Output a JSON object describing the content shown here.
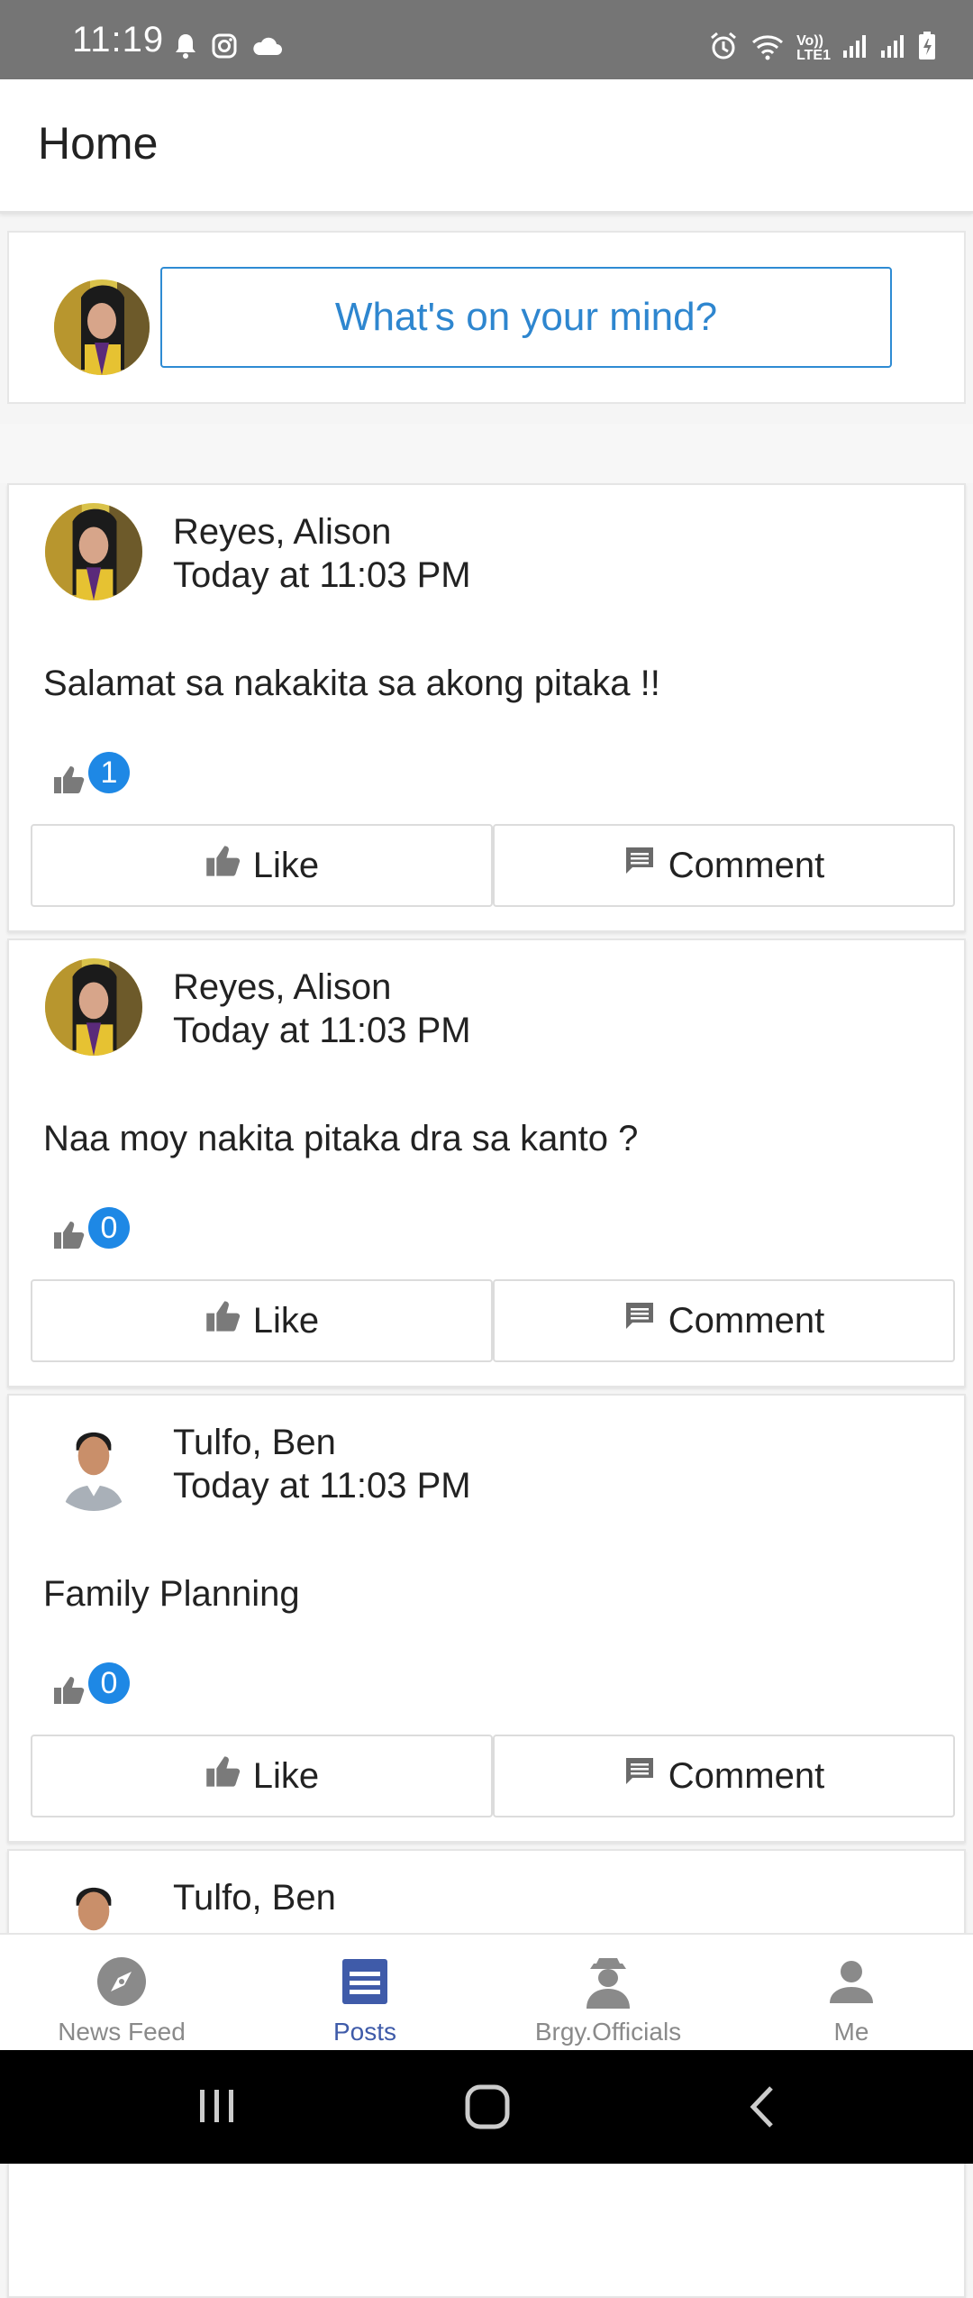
{
  "status_bar": {
    "time": "11:19",
    "lte": "LTE1",
    "vo": "Vo))",
    "icons": [
      "bell-icon",
      "instagram-icon",
      "cloud-icon",
      "alarm-icon",
      "wifi-icon",
      "signal-icon",
      "battery-icon"
    ]
  },
  "header": {
    "title": "Home"
  },
  "composer": {
    "placeholder": "What's on your mind?"
  },
  "posts": [
    {
      "author": "Reyes, Alison",
      "time": "Today at 11:03 PM",
      "text": "Salamat sa nakakita sa akong pitaka !!",
      "likes": "1",
      "like_label": "Like",
      "comment_label": "Comment"
    },
    {
      "author": "Reyes, Alison",
      "time": "Today at 11:03 PM",
      "text": "Naa moy nakita pitaka dra sa kanto ?",
      "likes": "0",
      "like_label": "Like",
      "comment_label": "Comment"
    },
    {
      "author": "Tulfo, Ben",
      "time": "Today at 11:03 PM",
      "text": "Family Planning",
      "likes": "0",
      "like_label": "Like",
      "comment_label": "Comment"
    },
    {
      "author": "Tulfo, Ben"
    }
  ],
  "bottom_nav": {
    "items": [
      {
        "label": "News Feed",
        "icon": "compass-icon"
      },
      {
        "label": "Posts",
        "icon": "posts-icon",
        "active": true
      },
      {
        "label": "Brgy.Officials",
        "icon": "official-icon"
      },
      {
        "label": "Me",
        "icon": "person-icon"
      }
    ]
  },
  "colors": {
    "accent": "#2e86cf",
    "badge": "#1e88e5",
    "nav_active": "#3f5ba9",
    "status_bar": "#757575"
  }
}
